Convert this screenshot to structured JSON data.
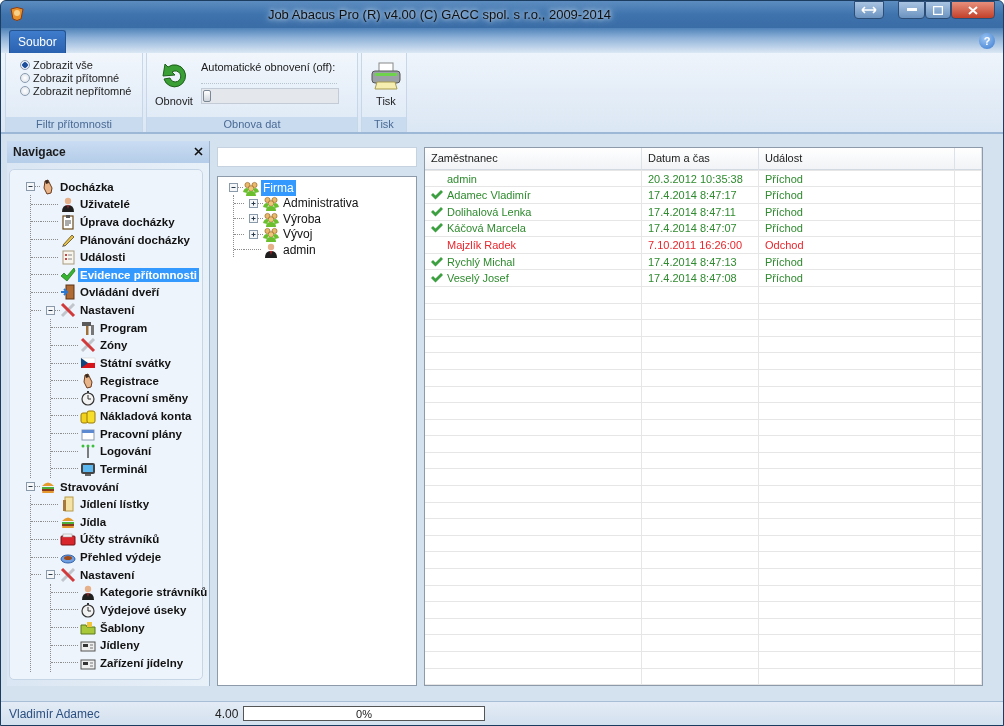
{
  "window": {
    "title": "Job Abacus Pro (R) v4.00 (C) GACC spol. s r.o., 2009-2014"
  },
  "menu_tabs": [
    {
      "label": "Soubor",
      "selected": true
    }
  ],
  "help_button": "?",
  "ribbon": {
    "filter": {
      "options": [
        {
          "label": "Zobrazit vše",
          "selected": true
        },
        {
          "label": "Zobrazit přítomné",
          "selected": false
        },
        {
          "label": "Zobrazit nepřítomné",
          "selected": false
        }
      ],
      "caption": "Filtr přítomnosti"
    },
    "refresh": {
      "button": "Obnovit",
      "slider_label": "Automatické obnovení (off):",
      "level": 0,
      "caption": "Obnova dat"
    },
    "print": {
      "button": "Tisk",
      "caption": "Tisk"
    }
  },
  "navigation": {
    "title": "Navigace",
    "items": [
      {
        "label": "Docházka",
        "selected": false,
        "expanded": true,
        "children": [
          {
            "label": "Uživatelé",
            "selected": false
          },
          {
            "label": "Úprava docházky",
            "selected": false
          },
          {
            "label": "Plánování docházky",
            "selected": false
          },
          {
            "label": "Události",
            "selected": false
          },
          {
            "label": "Evidence přítomnosti",
            "selected": true
          },
          {
            "label": "Ovládání dveří",
            "selected": false
          },
          {
            "label": "Nastavení",
            "selected": false,
            "expanded": true,
            "children": [
              {
                "label": "Program",
                "selected": false
              },
              {
                "label": "Zóny",
                "selected": false
              },
              {
                "label": "Státní svátky",
                "selected": false
              },
              {
                "label": "Registrace",
                "selected": false
              },
              {
                "label": "Pracovní směny",
                "selected": false
              },
              {
                "label": "Nákladová konta",
                "selected": false
              },
              {
                "label": "Pracovní plány",
                "selected": false
              },
              {
                "label": "Logování",
                "selected": false
              },
              {
                "label": "Terminál",
                "selected": false
              }
            ]
          }
        ]
      },
      {
        "label": "Stravování",
        "selected": false,
        "expanded": true,
        "children": [
          {
            "label": "Jídlení lístky",
            "selected": false
          },
          {
            "label": "Jídla",
            "selected": false
          },
          {
            "label": "Účty strávníků",
            "selected": false
          },
          {
            "label": "Přehled výdeje",
            "selected": false
          },
          {
            "label": "Nastavení",
            "selected": false,
            "expanded": true,
            "children": [
              {
                "label": "Kategorie strávníků",
                "selected": false
              },
              {
                "label": "Výdejové úseky",
                "selected": false
              },
              {
                "label": "Šablony",
                "selected": false
              },
              {
                "label": "Jídleny",
                "selected": false
              },
              {
                "label": "Zařízení jídelny",
                "selected": false
              }
            ]
          }
        ]
      }
    ]
  },
  "org_tree": {
    "items": [
      {
        "label": "Firma",
        "kind": "group",
        "selected": true,
        "expanded": true,
        "children": [
          {
            "label": "Administrativa",
            "kind": "group",
            "selected": false,
            "expanded": false
          },
          {
            "label": "Výroba",
            "kind": "group",
            "selected": false,
            "expanded": false
          },
          {
            "label": "Vývoj",
            "kind": "group",
            "selected": false,
            "expanded": false
          },
          {
            "label": "admin",
            "kind": "person",
            "selected": false
          }
        ]
      }
    ]
  },
  "table": {
    "columns": [
      "Zaměstnanec",
      "Datum a čas",
      "Událost"
    ],
    "rows": [
      {
        "cells": [
          "admin",
          "20.3.2012 10:35:38",
          "Příchod"
        ],
        "checked": false,
        "color": "#2e8b2e"
      },
      {
        "cells": [
          "Adamec Vladimír",
          "17.4.2014 8:47:17",
          "Příchod"
        ],
        "checked": true,
        "color": "#2e8b2e"
      },
      {
        "cells": [
          "Dolihalová Lenka",
          "17.4.2014 8:47:11",
          "Příchod"
        ],
        "checked": true,
        "color": "#2e8b2e"
      },
      {
        "cells": [
          "Káčová Marcela",
          "17.4.2014 8:47:07",
          "Příchod"
        ],
        "checked": true,
        "color": "#2e8b2e"
      },
      {
        "cells": [
          "Majzlík Radek",
          "7.10.2011 16:26:00",
          "Odchod"
        ],
        "checked": false,
        "color": "#e8262c"
      },
      {
        "cells": [
          "Rychlý Michal",
          "17.4.2014 8:47:13",
          "Příchod"
        ],
        "checked": true,
        "color": "#2e8b2e"
      },
      {
        "cells": [
          "Veselý Josef",
          "17.4.2014 8:47:08",
          "Příchod"
        ],
        "checked": true,
        "color": "#2e8b2e"
      }
    ]
  },
  "status_bar": {
    "user": "Vladimír Adamec",
    "version": "4.00",
    "progress": {
      "level": 0,
      "label": "0%"
    }
  }
}
